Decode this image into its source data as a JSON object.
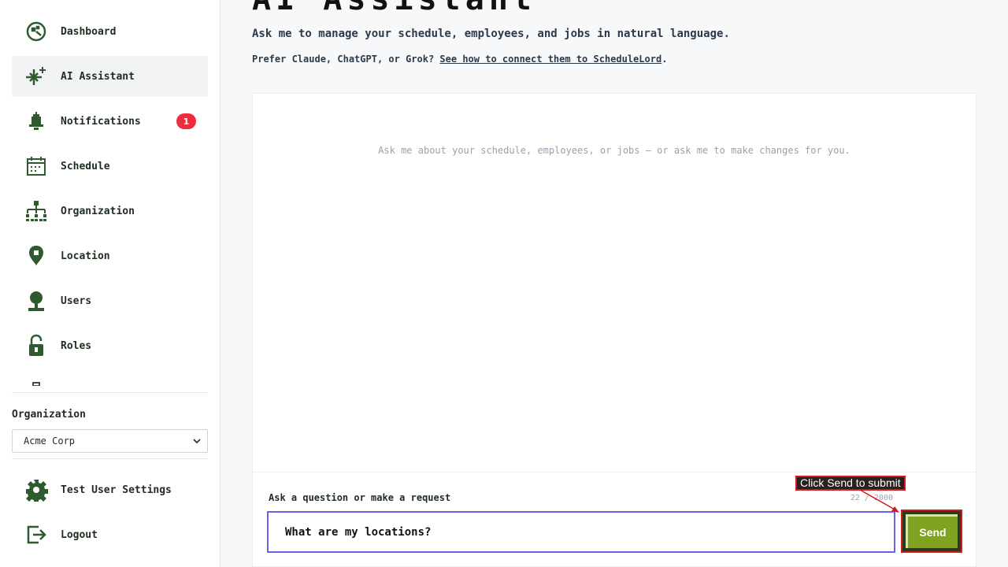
{
  "sidebar": {
    "items": [
      {
        "label": "Dashboard",
        "icon": "dashboard-icon"
      },
      {
        "label": "AI Assistant",
        "icon": "sparkle-icon",
        "active": true
      },
      {
        "label": "Notifications",
        "icon": "bell-icon",
        "badge": "1"
      },
      {
        "label": "Schedule",
        "icon": "calendar-icon"
      },
      {
        "label": "Organization",
        "icon": "org-chart-icon"
      },
      {
        "label": "Location",
        "icon": "map-pin-icon"
      },
      {
        "label": "Users",
        "icon": "user-icon"
      },
      {
        "label": "Roles",
        "icon": "lock-icon"
      }
    ],
    "organization_label": "Organization",
    "organization_selected": "Acme Corp",
    "bottom_items": [
      {
        "label": "Test User Settings",
        "icon": "gear-icon"
      },
      {
        "label": "Logout",
        "icon": "logout-icon"
      }
    ]
  },
  "main": {
    "title": "AI Assistant",
    "subtitle": "Ask me to manage your schedule, employees, and jobs in natural language.",
    "hint_prefix": "Prefer Claude, ChatGPT, or Grok? ",
    "hint_link": "See how to connect them to ScheduleLord",
    "hint_suffix": ".",
    "empty_message": "Ask me about your schedule, employees, or jobs — or ask me to make changes for you.",
    "composer": {
      "label": "Ask a question or make a request",
      "value": "What are my locations?",
      "char_count": "22 / 2000",
      "send_label": "Send"
    },
    "tooltip": "Click Send to submit"
  },
  "colors": {
    "icon": "#2f5a2f",
    "badge": "#ef2c3c",
    "input_border": "#6a62e6",
    "send": "#7fa320",
    "annotation": "#d21a1a"
  }
}
